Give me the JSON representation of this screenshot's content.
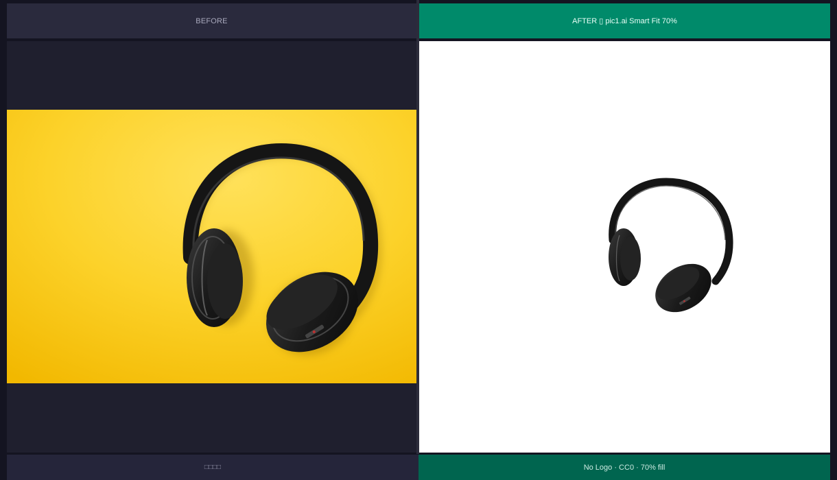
{
  "before": {
    "header_label": "BEFORE",
    "footer_label": "□□□□"
  },
  "after": {
    "header_label": "AFTER ▯ pic1.ai  Smart Fit 70%",
    "footer_label": "No Logo · CC0 · 70% fill"
  },
  "colors": {
    "before_header_bg": "#2a2a3d",
    "after_header_bg": "#008a6a",
    "after_footer_bg": "#00654f",
    "photo_background": "#f7c600",
    "after_background": "#ffffff"
  },
  "images": {
    "before": "headphones-on-yellow-photo",
    "after": "headphones-cutout-on-white"
  }
}
